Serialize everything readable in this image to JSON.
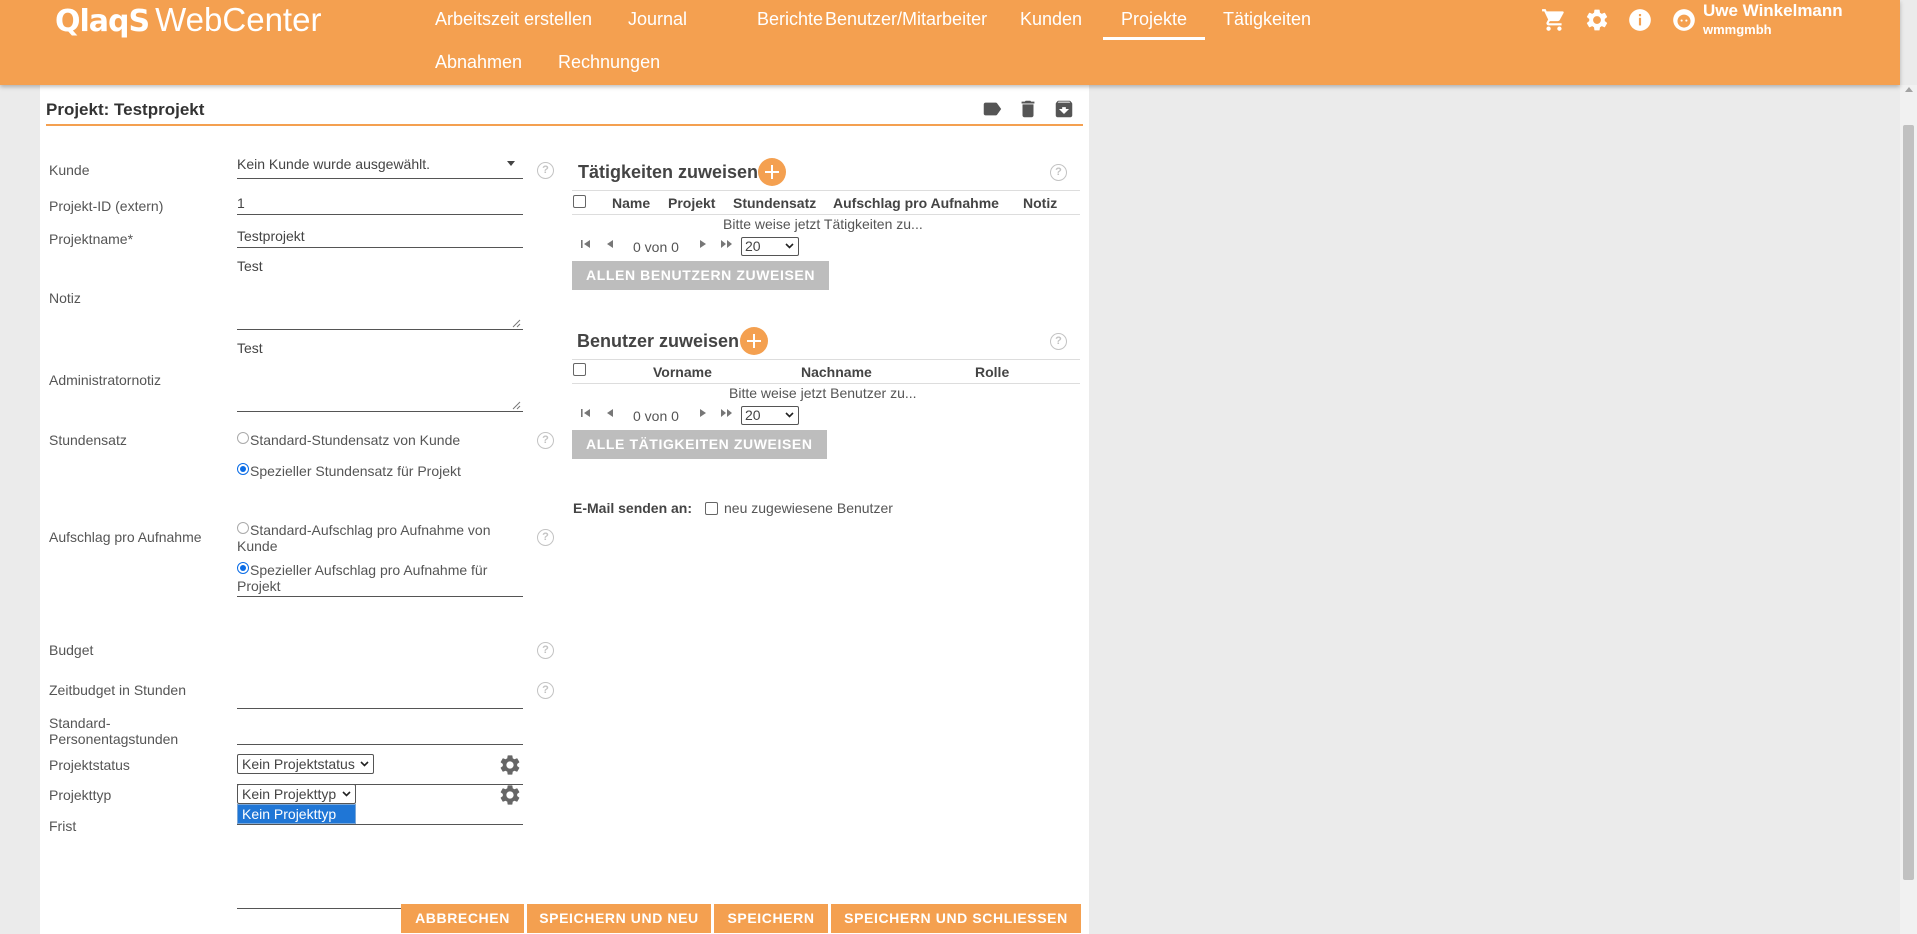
{
  "app": {
    "brand": "QlaqS",
    "product": "WebCenter"
  },
  "nav": {
    "row1": [
      "Arbeitszeit erstellen",
      "Journal",
      "Berichte",
      "Benutzer/Mitarbeiter",
      "Kunden",
      "Projekte",
      "Tätigkeiten"
    ],
    "row2": [
      "Abnahmen",
      "Rechnungen"
    ],
    "active": "Projekte"
  },
  "user": {
    "name": "Uwe Winkelmann",
    "org": "wmmgmbh"
  },
  "icons": {
    "cart": "cart-icon",
    "settings": "gear-icon",
    "info": "info-icon",
    "avatar": "avatar-icon",
    "tag": "tag-icon",
    "delete": "trash-icon",
    "archive": "archive-icon"
  },
  "colors": {
    "accent": "#f4a050",
    "grey_button": "#bdbdbd",
    "selection": "#1f76d6"
  },
  "page": {
    "title": "Projekt: Testprojekt"
  },
  "form": {
    "kunde": {
      "label": "Kunde",
      "value": "Kein Kunde wurde ausgewählt."
    },
    "projekt_id": {
      "label": "Projekt-ID (extern)",
      "value": "1"
    },
    "projektname": {
      "label": "Projektname*",
      "value": "Testprojekt"
    },
    "notiz": {
      "label": "Notiz",
      "value": "Test"
    },
    "admin_notiz": {
      "label": "Administratornotiz",
      "value": "Test"
    },
    "stundensatz": {
      "label": "Stundensatz",
      "option1": "Standard-Stundensatz von Kunde",
      "option2": "Spezieller Stundensatz für Projekt",
      "selected": 2,
      "value": ""
    },
    "aufschlag": {
      "label": "Aufschlag pro Aufnahme",
      "option1_line1": "Standard-Aufschlag pro Aufnahme von",
      "option1_line2": "Kunde",
      "option2_line1": "Spezieller Aufschlag pro Aufnahme für",
      "option2_line2": "Projekt",
      "selected": 2,
      "value": ""
    },
    "budget": {
      "label": "Budget",
      "value": ""
    },
    "zeitbudget": {
      "label": "Zeitbudget in Stunden",
      "value": ""
    },
    "personentage": {
      "label_line1": "Standard-",
      "label_line2": "Personentagstunden",
      "value": ""
    },
    "projektstatus": {
      "label": "Projektstatus",
      "value": "Kein Projektstatus"
    },
    "projekttyp": {
      "label": "Projekttyp",
      "value": "Kein Projekttyp",
      "open_option": "Kein Projekttyp"
    },
    "frist": {
      "label": "Frist",
      "value": ""
    }
  },
  "activities": {
    "title": "Tätigkeiten zuweisen",
    "columns": [
      "Name",
      "Projekt",
      "Stundensatz",
      "Aufschlag pro Aufnahme",
      "Notiz"
    ],
    "empty": "Bitte weise jetzt Tätigkeiten zu...",
    "pager": "0 von 0",
    "page_size": "20",
    "button": "ALLEN BENUTZERN ZUWEISEN"
  },
  "users": {
    "title": "Benutzer zuweisen",
    "columns": [
      "Vorname",
      "Nachname",
      "Rolle"
    ],
    "empty": "Bitte weise jetzt Benutzer zu...",
    "pager": "0 von 0",
    "page_size": "20",
    "button": "ALLE TÄTIGKEITEN ZUWEISEN"
  },
  "email": {
    "label": "E-Mail senden an:",
    "option": "neu zugewiesene Benutzer"
  },
  "actions": {
    "cancel": "ABBRECHEN",
    "save_new": "SPEICHERN UND NEU",
    "save": "SPEICHERN",
    "save_close": "SPEICHERN UND SCHLIESSEN"
  }
}
